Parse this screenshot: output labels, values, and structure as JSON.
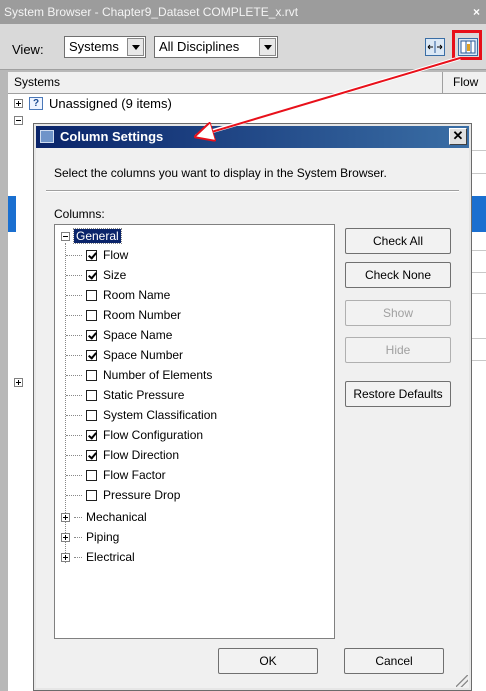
{
  "system_browser": {
    "title": "System Browser - Chapter9_Dataset COMPLETE_x.rvt",
    "close_label": "×",
    "view_label": "View:",
    "view_select": "Systems",
    "discipline_select": "All Disciplines",
    "header": {
      "systems": "Systems",
      "flow": "Flow"
    },
    "first_row": "Unassigned (9 items)"
  },
  "dialog": {
    "title": "Column Settings",
    "close_label": "✕",
    "instructions": "Select the columns you want to display in the System Browser.",
    "columns_label": "Columns:",
    "tree": {
      "general": "General",
      "general_items": [
        {
          "label": "Flow",
          "checked": true
        },
        {
          "label": "Size",
          "checked": true
        },
        {
          "label": "Room Name",
          "checked": false
        },
        {
          "label": "Room Number",
          "checked": false
        },
        {
          "label": "Space Name",
          "checked": true
        },
        {
          "label": "Space Number",
          "checked": true
        },
        {
          "label": "Number of Elements",
          "checked": false
        },
        {
          "label": "Static Pressure",
          "checked": false
        },
        {
          "label": "System Classification",
          "checked": false
        },
        {
          "label": "Flow Configuration",
          "checked": true
        },
        {
          "label": "Flow Direction",
          "checked": true
        },
        {
          "label": "Flow Factor",
          "checked": false
        },
        {
          "label": "Pressure Drop",
          "checked": false
        }
      ],
      "others": [
        "Mechanical",
        "Piping",
        "Electrical"
      ]
    },
    "buttons": {
      "check_all": "Check All",
      "check_none": "Check None",
      "show": "Show",
      "hide": "Hide",
      "restore_defaults": "Restore Defaults",
      "ok": "OK",
      "cancel": "Cancel"
    }
  },
  "colors": {
    "title_gradient_start": "#0a246a",
    "title_gradient_end": "#3a6ea5",
    "callout_red": "#e8101a",
    "selection_blue": "#1a6fd0"
  }
}
